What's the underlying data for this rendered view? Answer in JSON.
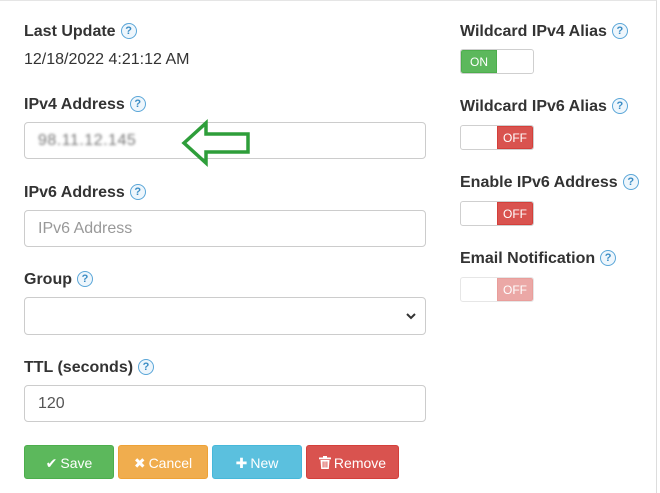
{
  "fields": {
    "last_update": {
      "label": "Last Update",
      "value": "12/18/2022 4:21:12 AM"
    },
    "ipv4": {
      "label": "IPv4 Address",
      "value": "98.11.12.145"
    },
    "ipv6": {
      "label": "IPv6 Address",
      "placeholder": "IPv6 Address",
      "value": ""
    },
    "group": {
      "label": "Group",
      "selected": ""
    },
    "ttl": {
      "label": "TTL (seconds)",
      "value": "120"
    }
  },
  "toggles": {
    "wildcard_ipv4": {
      "label": "Wildcard IPv4 Alias",
      "state": "ON"
    },
    "wildcard_ipv6": {
      "label": "Wildcard IPv6 Alias",
      "state": "OFF"
    },
    "enable_ipv6": {
      "label": "Enable IPv6 Address",
      "state": "OFF"
    },
    "email_notification": {
      "label": "Email Notification",
      "state": "OFF"
    }
  },
  "buttons": {
    "save": "Save",
    "cancel": "Cancel",
    "new": "New",
    "remove": "Remove"
  },
  "help_glyph": "?",
  "icons": {
    "save": "checkmark-icon",
    "cancel": "x-icon",
    "new": "plus-icon",
    "remove": "trash-icon",
    "annotation": "green-arrow-icon"
  },
  "colors": {
    "success": "#5cb85c",
    "warning": "#f0ad4e",
    "info": "#5bc0de",
    "danger": "#d9534f",
    "annotation_arrow": "#2e9e3a"
  }
}
